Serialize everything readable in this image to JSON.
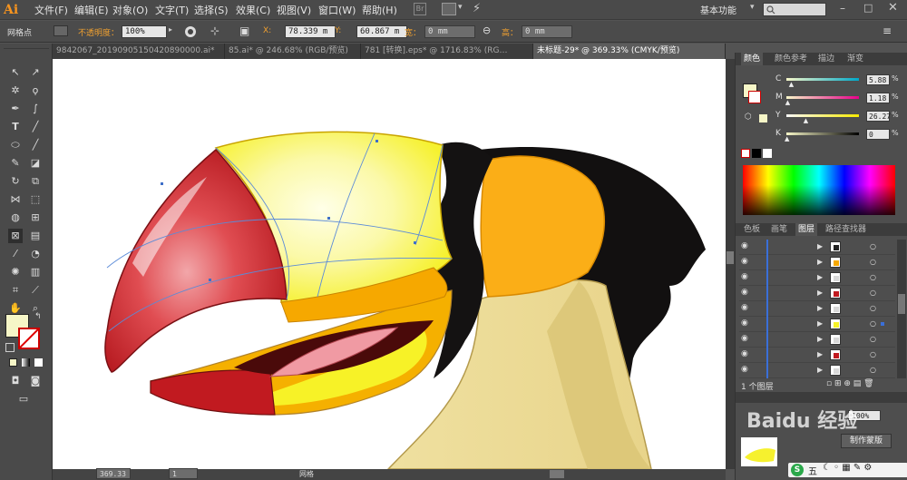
{
  "app": {
    "logo": "Ai",
    "workspace": "基本功能"
  },
  "menu": [
    "文件(F)",
    "编辑(E)",
    "对象(O)",
    "文字(T)",
    "选择(S)",
    "效果(C)",
    "视图(V)",
    "窗口(W)",
    "帮助(H)"
  ],
  "control": {
    "selection_label": "网格点",
    "opacity_label": "不透明度：",
    "opacity_value": "100%",
    "x_label": "X:",
    "x_value": "78.339 m",
    "y_label": "Y:",
    "y_value": "60.867 m",
    "w_label": "宽：",
    "w_value": "0 mm",
    "h_label": "高：",
    "h_value": "0 mm"
  },
  "tabs": [
    "9842067_20190905150420890000.ai*",
    "85.ai* @ 246.68% (RGB/预览)",
    "781 [转换].eps* @ 1716.83% (RG…",
    "未标题-29* @ 369.33% (CMYK/预览)"
  ],
  "color_panel": {
    "tabs": [
      "颜色",
      "颜色参考",
      "描边",
      "渐变"
    ],
    "channels": [
      {
        "label": "C",
        "value": "5.88",
        "pos": 0.06
      },
      {
        "label": "M",
        "value": "1.18",
        "pos": 0.01
      },
      {
        "label": "Y",
        "value": "26.27",
        "pos": 0.26
      },
      {
        "label": "K",
        "value": "0",
        "pos": 0.0
      }
    ],
    "fill_color": "#f6f6c7"
  },
  "layers_panel": {
    "tabs": [
      "色板",
      "画笔",
      "图层",
      "路径查找器"
    ],
    "footer": "1 个图层",
    "rows": 9
  },
  "bottom_panel": {
    "opacity_value": "100%",
    "mask_button": "制作蒙版",
    "watermark": "Baidu 经验"
  },
  "status": {
    "zoom": "369.33",
    "artboard": "1",
    "tool": "网格"
  },
  "ime": {
    "items": [
      "S",
      "五"
    ]
  }
}
